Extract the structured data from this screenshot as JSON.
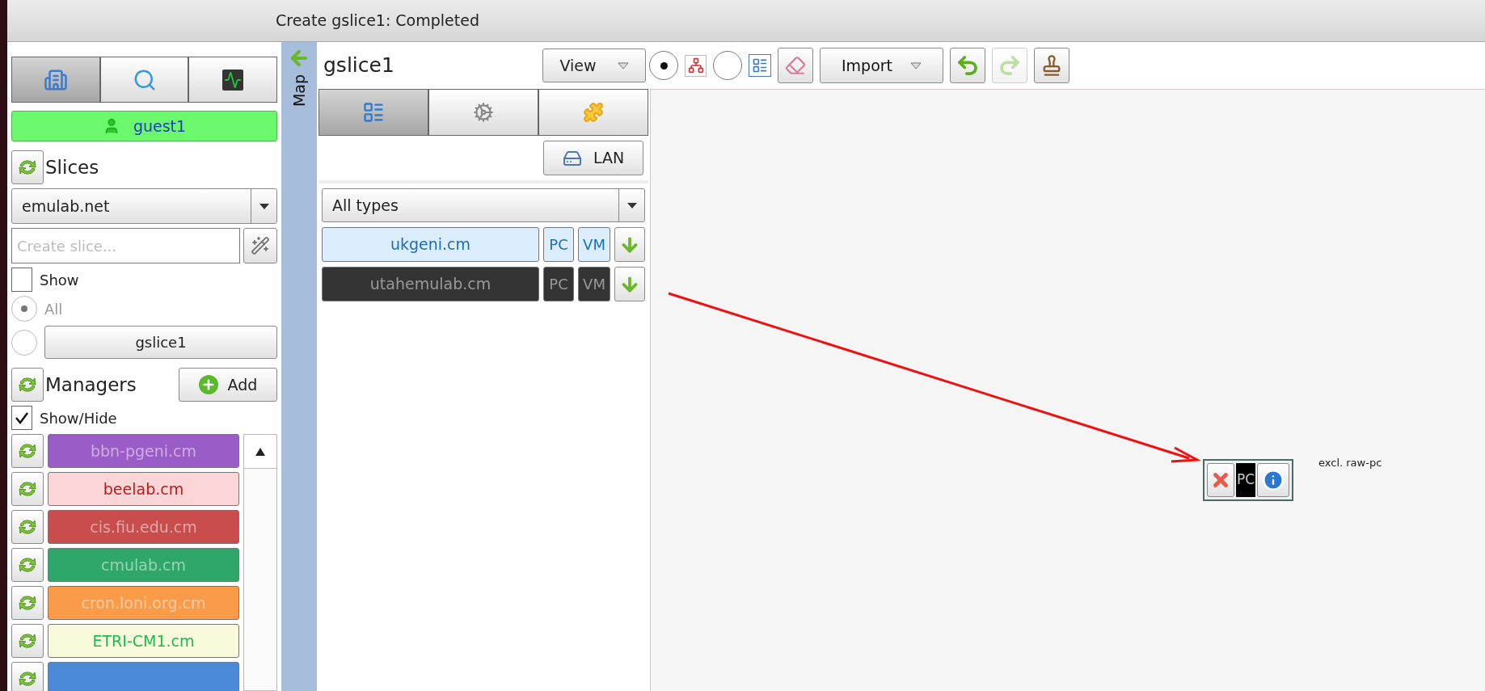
{
  "title_bar": {
    "title": "Create gslice1: Completed"
  },
  "left_tabs": [
    {
      "kind": "sites",
      "selected": true
    },
    {
      "kind": "search",
      "selected": false
    },
    {
      "kind": "monitor",
      "selected": false
    }
  ],
  "user": {
    "name": "guest1"
  },
  "slices": {
    "heading": "Slices",
    "authority": "emulab.net",
    "create_placeholder": "Create slice...",
    "show": {
      "label": "Show",
      "checked": false
    },
    "filter": [
      {
        "kind": "label",
        "label": "All",
        "selected": true
      },
      {
        "kind": "button",
        "label": "gslice1",
        "selected": false
      }
    ]
  },
  "managers": {
    "heading": "Managers",
    "add_label": "Add",
    "show_hide": {
      "label": "Show/Hide",
      "checked": true
    },
    "items": [
      {
        "name": "bbn-pgeni.cm",
        "color": "#9a5cc6"
      },
      {
        "name": "beelab.cm",
        "color": "#fcd6d6"
      },
      {
        "name": "cis.fiu.edu.cm",
        "color": "#c94d4d"
      },
      {
        "name": "cmulab.cm",
        "color": "#2fa76a"
      },
      {
        "name": "cron.loni.org.cm",
        "color": "#f99b48"
      },
      {
        "name": "ETRI-CM1.cm",
        "color": "#f8fadb"
      },
      {
        "color": "#4b8ad8"
      }
    ]
  },
  "map_strip": {
    "label": "Map"
  },
  "slice_panel": {
    "name": "gslice1",
    "view_label": "View",
    "tabs": [
      {
        "kind": "resources",
        "selected": true
      },
      {
        "kind": "settings",
        "selected": false
      },
      {
        "kind": "plugins",
        "selected": false
      }
    ],
    "lan_label": "LAN",
    "type_filter": "All types",
    "aggregates": [
      {
        "name": "ukgeni.cm",
        "pc": "PC",
        "vm": "VM",
        "color": "#dcedfd"
      },
      {
        "name": "utahemulab.cm",
        "pc": "PC",
        "vm": "VM",
        "color": "#343434"
      }
    ]
  },
  "toolbar": [
    {
      "kind": "radio",
      "selected": true
    },
    {
      "kind": "graph"
    },
    {
      "kind": "radio",
      "selected": false
    },
    {
      "kind": "list"
    },
    {
      "kind": "eraser"
    },
    {
      "kind": "import",
      "label": "Import"
    },
    {
      "kind": "undo",
      "disabled": false
    },
    {
      "kind": "redo",
      "disabled": true
    },
    {
      "kind": "stamp"
    }
  ],
  "canvas": {
    "node": {
      "type": "PC",
      "label": "excl. raw-pc"
    }
  }
}
